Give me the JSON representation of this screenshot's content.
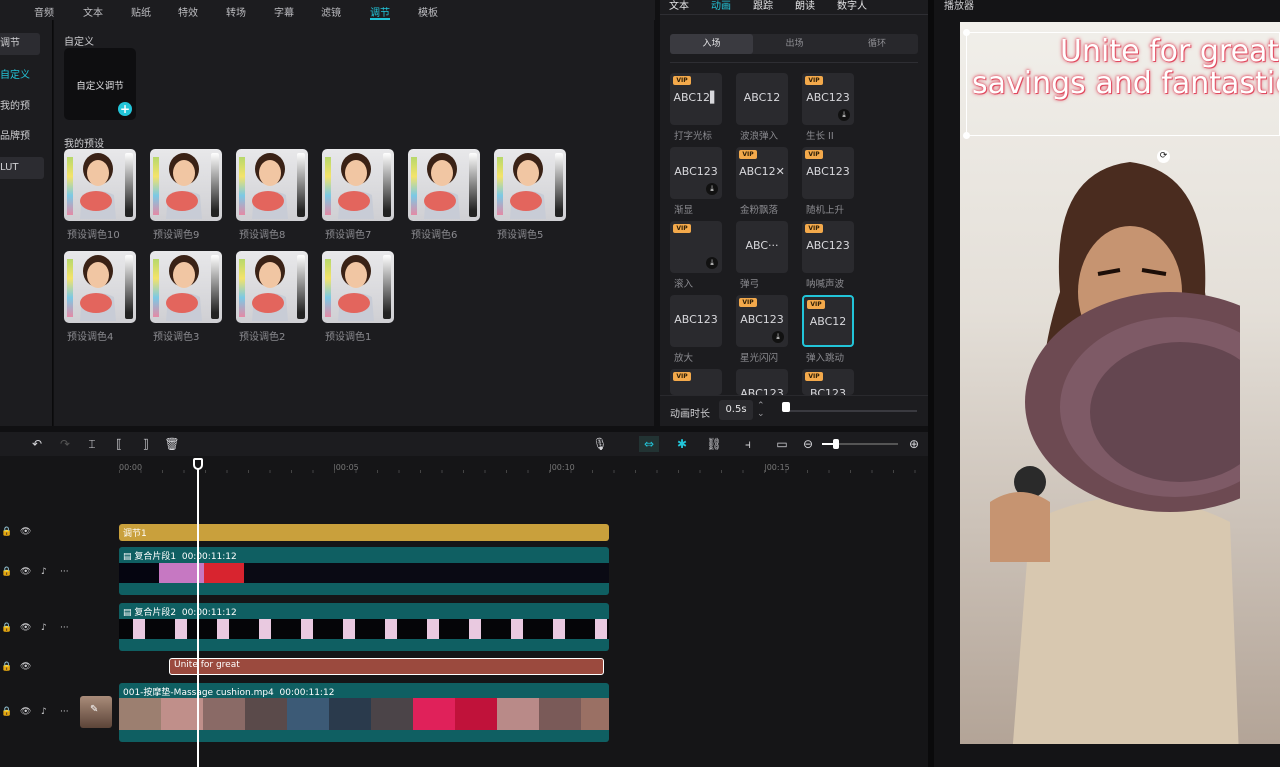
{
  "top_tabs": [
    {
      "label": "音频"
    },
    {
      "label": "文本"
    },
    {
      "label": "贴纸"
    },
    {
      "label": "特效"
    },
    {
      "label": "转场"
    },
    {
      "label": "字幕"
    },
    {
      "label": "滤镜"
    },
    {
      "label": "调节",
      "active": true
    },
    {
      "label": "模板"
    }
  ],
  "sidebar": {
    "items": [
      {
        "label": "调节"
      },
      {
        "label": "自定义"
      },
      {
        "label": "我的预设"
      },
      {
        "label": "品牌预设"
      },
      {
        "label": "LUT"
      }
    ]
  },
  "adjust": {
    "custom_section": "自定义",
    "custom_card_label": "自定义调节",
    "presets_section": "我的预设",
    "presets": [
      "预设调色10",
      "预设调色9",
      "预设调色8",
      "预设调色7",
      "预设调色6",
      "预设调色5",
      "预设调色4",
      "预设调色3",
      "预设调色2",
      "预设调色1"
    ]
  },
  "anim_panel": {
    "tabs": [
      "文本",
      "动画",
      "跟踪",
      "朗读",
      "数字人"
    ],
    "active_tab": "动画",
    "segments": [
      "入场",
      "出场",
      "循环"
    ],
    "tiles": [
      {
        "text": "ABC12▌",
        "name": "打字光标",
        "vip": true,
        "download": false
      },
      {
        "text": "ABC12",
        "name": "波浪弹入",
        "vip": false,
        "download": false
      },
      {
        "text": "ABC123",
        "name": "生长 II",
        "vip": true,
        "download": true
      },
      {
        "text": "ABC123",
        "name": "渐显",
        "vip": false,
        "download": true
      },
      {
        "text": "ABC12✕",
        "name": "金粉飘落",
        "vip": true,
        "download": false
      },
      {
        "text": "ABC123",
        "name": "随机上升",
        "vip": true,
        "download": false
      },
      {
        "text": "",
        "name": "滚入",
        "vip": true,
        "download": true
      },
      {
        "text": "ABC···",
        "name": "弹弓",
        "vip": false,
        "download": false
      },
      {
        "text": "ABC123",
        "name": "呐喊声波",
        "vip": true,
        "download": false
      },
      {
        "text": "ABC123",
        "name": "放大",
        "vip": false,
        "download": false
      },
      {
        "text": "ABC123",
        "name": "星光闪闪",
        "vip": true,
        "download": true
      },
      {
        "text": "ABC12",
        "name": "弹入跳动",
        "vip": true,
        "download": false,
        "selected": true
      },
      {
        "text": "",
        "name": "",
        "vip": true,
        "download": false
      },
      {
        "text": "ABC123",
        "name": "",
        "vip": false,
        "download": false
      },
      {
        "text": "BC123",
        "name": "",
        "vip": true,
        "download": false
      }
    ],
    "duration_label": "动画时长",
    "duration_value": "0.5s",
    "vip_badge": "VIP"
  },
  "player": {
    "title": "播放器",
    "overlay_line1": "Unite for great",
    "overlay_line2": "savings and fantastic d"
  },
  "timeline": {
    "ticks": [
      "00:00",
      "|00:05",
      "|00:10",
      "|00:15"
    ],
    "tracks": {
      "adjust": "调节1",
      "compound1": "复合片段1",
      "compound1_time": "00:00:11:12",
      "compound2": "复合片段2",
      "compound2_time": "00:00:11:12",
      "text": "Unite for great",
      "main": "001-按摩垫-Massage cushion.mp4",
      "main_time": "00:00:11:12"
    }
  },
  "colors": {
    "accent": "#22c5d9",
    "adjust_clip": "#c9a03c",
    "compound_clip": "#0f5f62",
    "text_clip": "#9b4a3e",
    "overlay_glow": "#e04a5f"
  }
}
